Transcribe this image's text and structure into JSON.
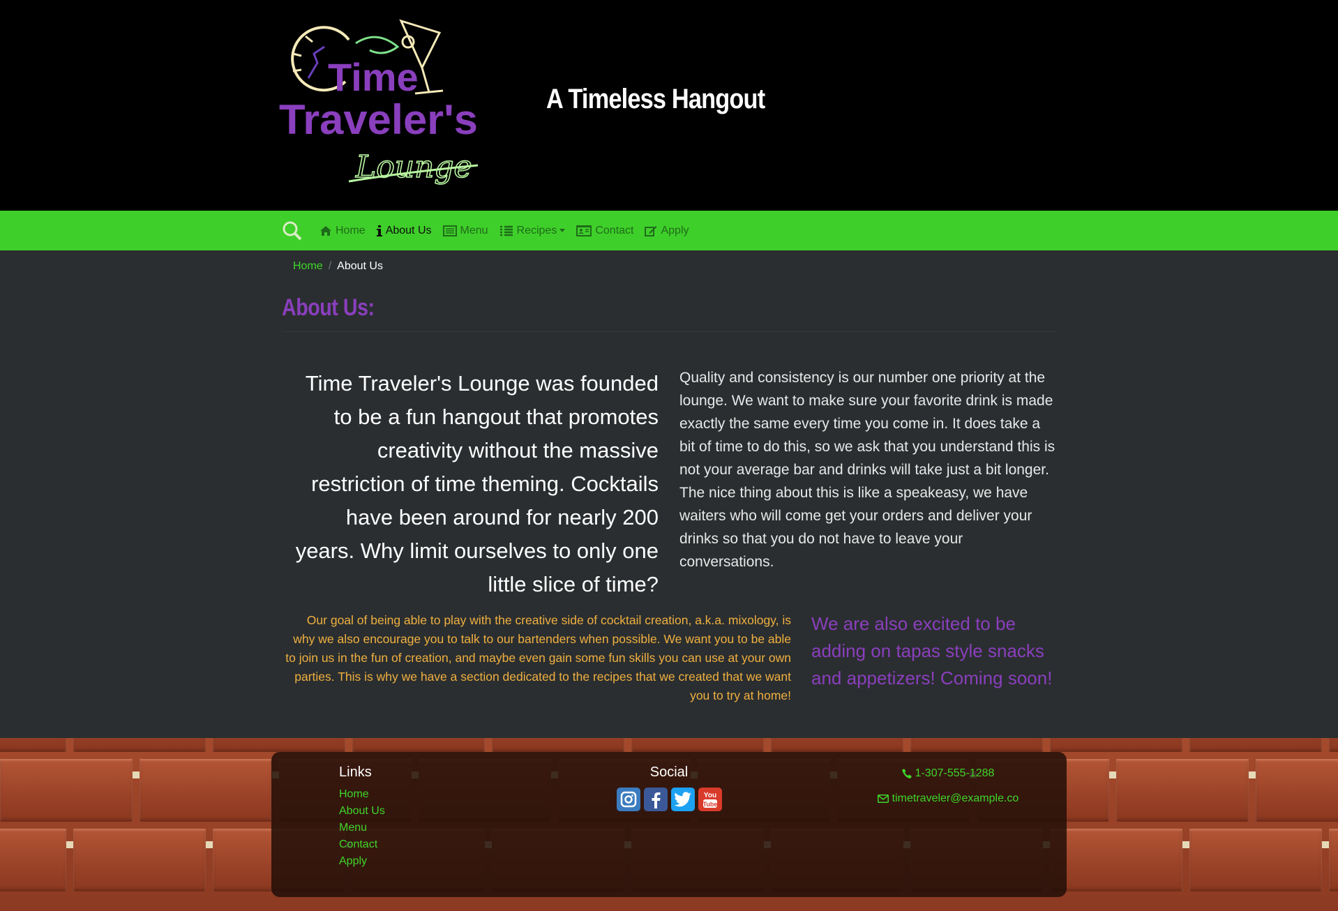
{
  "header": {
    "logo": {
      "line1": "Time",
      "line2": "Traveler's",
      "line3": "Lounge"
    },
    "tagline": "A Timeless Hangout"
  },
  "nav": {
    "items": [
      {
        "label": "Home",
        "icon": "home-icon"
      },
      {
        "label": "About Us",
        "icon": "info-icon"
      },
      {
        "label": "Menu",
        "icon": "list-alt-icon"
      },
      {
        "label": "Recipes",
        "icon": "list-icon"
      },
      {
        "label": "Contact",
        "icon": "address-card-icon"
      },
      {
        "label": "Apply",
        "icon": "edit-icon"
      }
    ]
  },
  "breadcrumb": {
    "home": "Home",
    "sep": "/",
    "current": "About Us"
  },
  "page": {
    "title": "About Us:",
    "lead": "Time Traveler's Lounge was founded to be a fun hangout that promotes creativity without the massive restriction of time theming. Cocktails have been around for nearly 200 years. Why limit ourselves to only one little slice of time?",
    "quality": "Quality and consistency is our number one priority at the lounge. We want to make sure your favorite drink is made exactly the same every time you come in. It does take a bit of time to do this, so we ask that you understand this is not your average bar and drinks will take just a bit longer. The nice thing about this is like a speakeasy, we have waiters who will come get your orders and deliver your drinks so that you do not have to leave your conversations.",
    "goal": "Our goal of being able to play with the creative side of cocktail creation, a.k.a. mixology, is why we also encourage you to talk to our bartenders when possible. We want you to be able to join us in the fun of creation, and maybe even gain some fun skills you can use at your own parties. This is why we have a section dedicated to the recipes that we created that we want you to try at home!",
    "snacks": "We are also excited to be adding on tapas style snacks and appetizers! Coming soon!"
  },
  "footer": {
    "links_heading": "Links",
    "links": [
      "Home",
      "About Us",
      "Menu",
      "Contact",
      "Apply"
    ],
    "social_heading": "Social",
    "social": [
      {
        "name": "instagram-icon",
        "color": "#3b7bbf"
      },
      {
        "name": "facebook-icon",
        "color": "#3b5998"
      },
      {
        "name": "twitter-icon",
        "color": "#1da1f2"
      },
      {
        "name": "youtube-icon",
        "color": "#d93b2b"
      }
    ],
    "phone": "1-307-555-1288",
    "email": "timetraveler@example.co"
  },
  "colors": {
    "nav_green": "#3fcf2a",
    "link_green": "#3fd62a",
    "purple": "#8a3fbd",
    "orange": "#f0b040",
    "content_bg": "#2a2e30"
  }
}
